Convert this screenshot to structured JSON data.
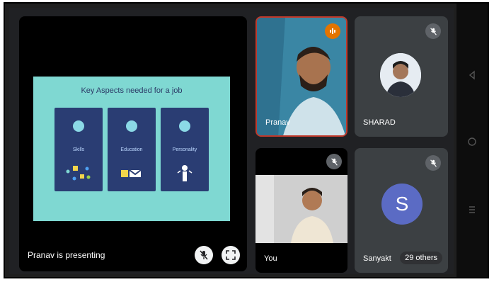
{
  "presentation": {
    "slide_title": "Key Aspects needed for a job",
    "cards": [
      {
        "label": "Skills"
      },
      {
        "label": "Education"
      },
      {
        "label": "Personality"
      }
    ],
    "presenting_label": "Pranav is presenting"
  },
  "participants": {
    "pranav": {
      "name": "Pranav"
    },
    "sharad": {
      "name": "SHARAD"
    },
    "you": {
      "name": "You"
    },
    "others": {
      "name": "Sanyakt",
      "avatar_letter": "S",
      "others_label": "29 others"
    }
  },
  "icons": {
    "mic_off": "mic-off-icon",
    "fullscreen": "fullscreen-icon",
    "speaking": "audio-level-icon"
  },
  "colors": {
    "meeting_bg": "#202124",
    "tile_bg": "#3c4043",
    "slide_bg": "#7fd8d2",
    "card_bg": "#2a3d73",
    "avatar_s": "#5b6bc4",
    "speaking_orange": "#e37400",
    "active_border": "#c0392b"
  }
}
